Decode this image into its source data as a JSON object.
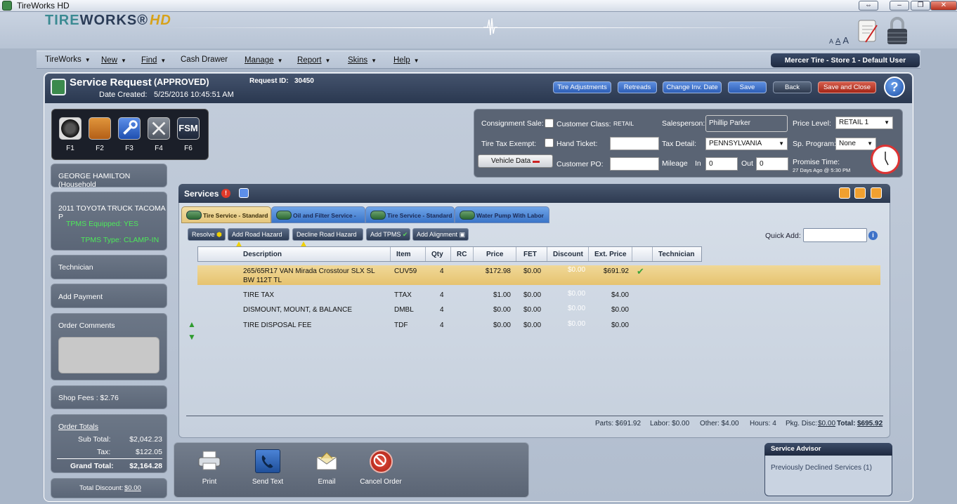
{
  "window": {
    "title": "TireWorks HD",
    "buttons": [
      "⇔",
      "–",
      "❐",
      "✕"
    ]
  },
  "header": {
    "logo_tire": "TIRE",
    "logo_works": "WORKS®",
    "logo_hd": "HD",
    "font_sizes": [
      "A",
      "A",
      "A"
    ]
  },
  "menu": [
    {
      "label": "TireWorks",
      "caret": true
    },
    {
      "label": "New",
      "caret": true
    },
    {
      "label": "Find",
      "caret": true
    },
    {
      "label": "Cash Drawer",
      "caret": false
    },
    {
      "label": "Manage",
      "caret": true
    },
    {
      "label": "Report",
      "caret": true
    },
    {
      "label": "Skins",
      "caret": true
    },
    {
      "label": "Help",
      "caret": true
    }
  ],
  "store_badge": "Mercer Tire - Store 1  -  Default User",
  "service_request": {
    "title": "Service Request",
    "status": "(APPROVED)",
    "date_label": "Date Created:",
    "date_value": "5/25/2016 10:45:51 AM",
    "id_label": "Request ID:",
    "id_value": "30450"
  },
  "header_buttons": {
    "tire_adjustments": "Tire Adjustments",
    "retreads": "Retreads",
    "change_inv_date": "Change Inv. Date",
    "save": "Save",
    "back": "Back",
    "save_close": "Save and Close",
    "help": "?"
  },
  "fkeys": [
    {
      "label": "F1",
      "icon": "tire-icon"
    },
    {
      "label": "F2",
      "icon": "package-icon"
    },
    {
      "label": "F3",
      "icon": "wrench-icon"
    },
    {
      "label": "F4",
      "icon": "tools-icon"
    },
    {
      "label": "F6",
      "icon": "fsm-icon",
      "text": "FSM"
    }
  ],
  "left": {
    "customer": "GEORGE HAMILTON (Household",
    "vehicle": "2011 TOYOTA TRUCK TACOMA P",
    "tpms_equipped_label": "TPMS Equipped:",
    "tpms_equipped_value": "YES",
    "tpms_type_label": "TPMS Type:",
    "tpms_type_value": "CLAMP-IN",
    "technician": "Technician",
    "add_payment": "Add Payment",
    "order_comments": "Order Comments",
    "shop_fees": "Shop Fees :   $2.76",
    "order_totals": "Order Totals",
    "subtotal_label": "Sub Total:",
    "subtotal_value": "$2,042.23",
    "tax_label": "Tax:",
    "tax_value": "$122.05",
    "grand_label": "Grand Total:",
    "grand_value": "$2,164.28",
    "total_discount_label": "Total Discount:",
    "total_discount_value": "$0.00"
  },
  "form": {
    "consignment_label": "Consignment Sale:",
    "customer_class_label": "Customer Class:",
    "customer_class_value": "RETAIL",
    "salesperson_label": "Salesperson:",
    "salesperson_value": "Phillip Parker",
    "price_level_label": "Price Level:",
    "price_level_value": "RETAIL 1",
    "tire_tax_exempt_label": "Tire Tax Exempt:",
    "hand_ticket_label": "Hand Ticket:",
    "tax_detail_label": "Tax Detail:",
    "tax_detail_value": "PENNSYLVANIA",
    "sp_program_label": "Sp. Program:",
    "sp_program_value": "None",
    "vehicle_data": "Vehicle Data",
    "customer_po_label": "Customer PO:",
    "mileage_label": "Mileage",
    "in_label": "In",
    "in_value": "0",
    "out_label": "Out",
    "out_value": "0",
    "promise_label": "Promise Time:",
    "promise_value": "27 Days Ago @ 5:30 PM"
  },
  "services": {
    "title": "Services",
    "tabs": [
      {
        "label": "Tire Service - Standard",
        "active": true
      },
      {
        "label": "Oil and Filter Service - F...",
        "active": false
      },
      {
        "label": "Tire Service - Standard",
        "active": false
      },
      {
        "label": "Water Pump With Labor",
        "active": false
      }
    ],
    "actions": {
      "resolve": "Resolve",
      "add_road_hazard": "Add Road Hazard",
      "decline_road_hazard": "Decline Road Hazard",
      "add_tpms": "Add TPMS",
      "add_alignment": "Add Alignment"
    },
    "quick_add_label": "Quick Add:",
    "columns": [
      "Description",
      "Item",
      "Qty",
      "RC",
      "Price",
      "FET",
      "Discount",
      "Ext. Price",
      "Technician"
    ],
    "rows": [
      {
        "desc": "265/65R17 VAN Mirada Crosstour SLX SL",
        "desc2": "BW 112T TL",
        "item": "CUV59",
        "qty": "4",
        "price": "$172.98",
        "fet": "$0.00",
        "discount": "$0.00",
        "ext": "$691.92",
        "selected": true
      },
      {
        "desc": "TIRE TAX",
        "desc2": "",
        "item": "TTAX",
        "qty": "4",
        "price": "$1.00",
        "fet": "$0.00",
        "discount": "$0.00",
        "ext": "$4.00",
        "selected": false
      },
      {
        "desc": "DISMOUNT, MOUNT, & BALANCE",
        "desc2": "",
        "item": "DMBL",
        "qty": "4",
        "price": "$0.00",
        "fet": "$0.00",
        "discount": "$0.00",
        "ext": "$0.00",
        "selected": false
      },
      {
        "desc": "TIRE DISPOSAL FEE",
        "desc2": "",
        "item": "TDF",
        "qty": "4",
        "price": "$0.00",
        "fet": "$0.00",
        "discount": "$0.00",
        "ext": "$0.00",
        "selected": false
      }
    ],
    "summary": {
      "parts": "Parts: $691.92",
      "labor": "Labor: $0.00",
      "other": "Other: $4.00",
      "hours": "Hours: 4",
      "pkg_label": "Pkg. Disc:",
      "pkg_value": "$0.00",
      "total_label": "Total:",
      "total_value": "$695.92"
    }
  },
  "bottom_actions": [
    {
      "label": "Print",
      "icon": "printer-icon"
    },
    {
      "label": "Send Text",
      "icon": "phone-icon"
    },
    {
      "label": "Email",
      "icon": "envelope-icon"
    },
    {
      "label": "Cancel Order",
      "icon": "cancel-icon"
    }
  ],
  "service_advisor": {
    "title": "Service Advisor",
    "text": "Previously Declined Services (1)"
  }
}
